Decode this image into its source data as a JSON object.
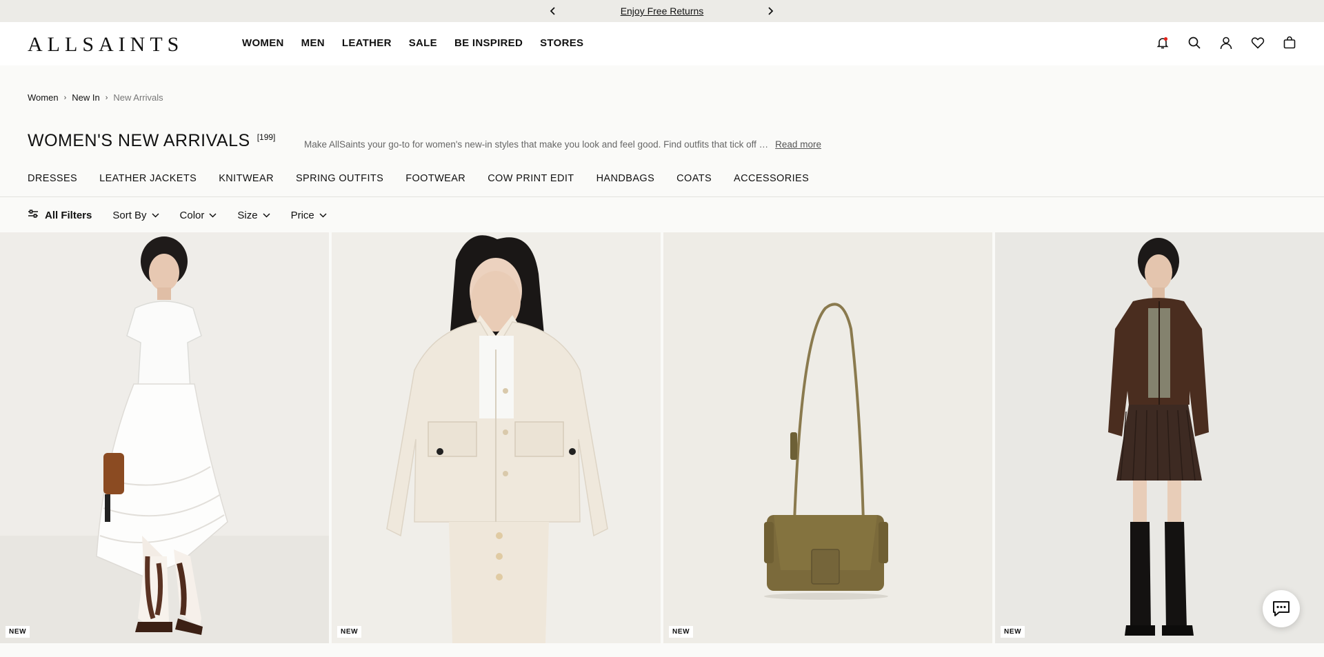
{
  "announcement": {
    "message": "Enjoy Free Returns"
  },
  "header": {
    "logo": "ALLSAINTS",
    "nav": [
      "WOMEN",
      "MEN",
      "LEATHER",
      "SALE",
      "BE INSPIRED",
      "STORES"
    ]
  },
  "breadcrumb": [
    "Women",
    "New In",
    "New Arrivals"
  ],
  "page": {
    "title": "WOMEN'S NEW ARRIVALS",
    "count": "[199]",
    "description": "Make AllSaints your go-to for women's new-in styles that make you look and feel good. Find outfits that tick off …",
    "read_more": "Read more"
  },
  "categories": [
    "DRESSES",
    "LEATHER JACKETS",
    "KNITWEAR",
    "SPRING OUTFITS",
    "FOOTWEAR",
    "COW PRINT EDIT",
    "HANDBAGS",
    "COATS",
    "ACCESSORIES"
  ],
  "filters": {
    "all_filters": "All Filters",
    "dropdowns": [
      "Sort By",
      "Color",
      "Size",
      "Price"
    ]
  },
  "products": [
    {
      "badge": "NEW",
      "image": "white-tiered-dress"
    },
    {
      "badge": "NEW",
      "image": "cream-denim-jacket"
    },
    {
      "badge": "NEW",
      "image": "suede-crossbody-bag"
    },
    {
      "badge": "NEW",
      "image": "brown-suede-jacket-pleated-skirt"
    }
  ],
  "colors": {
    "announce_bg": "#ecebe7",
    "page_bg": "#fafaf8",
    "card_bg": "#efede8"
  }
}
